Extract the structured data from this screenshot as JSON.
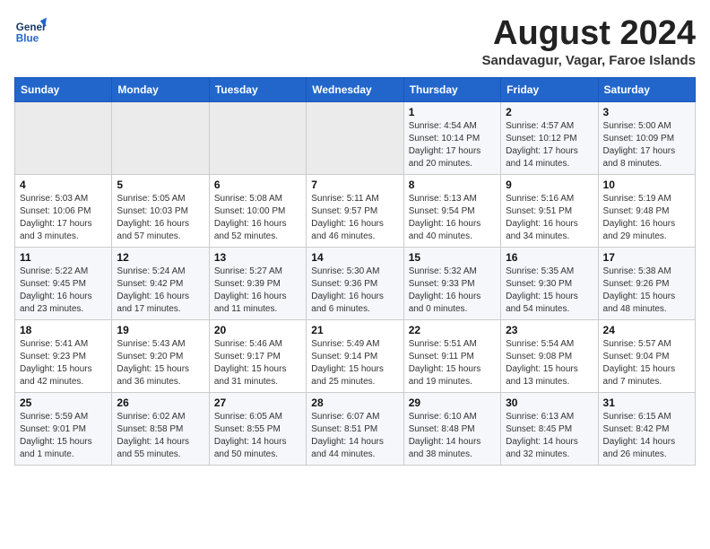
{
  "header": {
    "logo_line1": "General",
    "logo_line2": "Blue",
    "main_title": "August 2024",
    "subtitle": "Sandavagur, Vagar, Faroe Islands"
  },
  "calendar": {
    "days_of_week": [
      "Sunday",
      "Monday",
      "Tuesday",
      "Wednesday",
      "Thursday",
      "Friday",
      "Saturday"
    ],
    "weeks": [
      [
        {
          "day": "",
          "info": ""
        },
        {
          "day": "",
          "info": ""
        },
        {
          "day": "",
          "info": ""
        },
        {
          "day": "",
          "info": ""
        },
        {
          "day": "1",
          "info": "Sunrise: 4:54 AM\nSunset: 10:14 PM\nDaylight: 17 hours\nand 20 minutes."
        },
        {
          "day": "2",
          "info": "Sunrise: 4:57 AM\nSunset: 10:12 PM\nDaylight: 17 hours\nand 14 minutes."
        },
        {
          "day": "3",
          "info": "Sunrise: 5:00 AM\nSunset: 10:09 PM\nDaylight: 17 hours\nand 8 minutes."
        }
      ],
      [
        {
          "day": "4",
          "info": "Sunrise: 5:03 AM\nSunset: 10:06 PM\nDaylight: 17 hours\nand 3 minutes."
        },
        {
          "day": "5",
          "info": "Sunrise: 5:05 AM\nSunset: 10:03 PM\nDaylight: 16 hours\nand 57 minutes."
        },
        {
          "day": "6",
          "info": "Sunrise: 5:08 AM\nSunset: 10:00 PM\nDaylight: 16 hours\nand 52 minutes."
        },
        {
          "day": "7",
          "info": "Sunrise: 5:11 AM\nSunset: 9:57 PM\nDaylight: 16 hours\nand 46 minutes."
        },
        {
          "day": "8",
          "info": "Sunrise: 5:13 AM\nSunset: 9:54 PM\nDaylight: 16 hours\nand 40 minutes."
        },
        {
          "day": "9",
          "info": "Sunrise: 5:16 AM\nSunset: 9:51 PM\nDaylight: 16 hours\nand 34 minutes."
        },
        {
          "day": "10",
          "info": "Sunrise: 5:19 AM\nSunset: 9:48 PM\nDaylight: 16 hours\nand 29 minutes."
        }
      ],
      [
        {
          "day": "11",
          "info": "Sunrise: 5:22 AM\nSunset: 9:45 PM\nDaylight: 16 hours\nand 23 minutes."
        },
        {
          "day": "12",
          "info": "Sunrise: 5:24 AM\nSunset: 9:42 PM\nDaylight: 16 hours\nand 17 minutes."
        },
        {
          "day": "13",
          "info": "Sunrise: 5:27 AM\nSunset: 9:39 PM\nDaylight: 16 hours\nand 11 minutes."
        },
        {
          "day": "14",
          "info": "Sunrise: 5:30 AM\nSunset: 9:36 PM\nDaylight: 16 hours\nand 6 minutes."
        },
        {
          "day": "15",
          "info": "Sunrise: 5:32 AM\nSunset: 9:33 PM\nDaylight: 16 hours\nand 0 minutes."
        },
        {
          "day": "16",
          "info": "Sunrise: 5:35 AM\nSunset: 9:30 PM\nDaylight: 15 hours\nand 54 minutes."
        },
        {
          "day": "17",
          "info": "Sunrise: 5:38 AM\nSunset: 9:26 PM\nDaylight: 15 hours\nand 48 minutes."
        }
      ],
      [
        {
          "day": "18",
          "info": "Sunrise: 5:41 AM\nSunset: 9:23 PM\nDaylight: 15 hours\nand 42 minutes."
        },
        {
          "day": "19",
          "info": "Sunrise: 5:43 AM\nSunset: 9:20 PM\nDaylight: 15 hours\nand 36 minutes."
        },
        {
          "day": "20",
          "info": "Sunrise: 5:46 AM\nSunset: 9:17 PM\nDaylight: 15 hours\nand 31 minutes."
        },
        {
          "day": "21",
          "info": "Sunrise: 5:49 AM\nSunset: 9:14 PM\nDaylight: 15 hours\nand 25 minutes."
        },
        {
          "day": "22",
          "info": "Sunrise: 5:51 AM\nSunset: 9:11 PM\nDaylight: 15 hours\nand 19 minutes."
        },
        {
          "day": "23",
          "info": "Sunrise: 5:54 AM\nSunset: 9:08 PM\nDaylight: 15 hours\nand 13 minutes."
        },
        {
          "day": "24",
          "info": "Sunrise: 5:57 AM\nSunset: 9:04 PM\nDaylight: 15 hours\nand 7 minutes."
        }
      ],
      [
        {
          "day": "25",
          "info": "Sunrise: 5:59 AM\nSunset: 9:01 PM\nDaylight: 15 hours\nand 1 minute."
        },
        {
          "day": "26",
          "info": "Sunrise: 6:02 AM\nSunset: 8:58 PM\nDaylight: 14 hours\nand 55 minutes."
        },
        {
          "day": "27",
          "info": "Sunrise: 6:05 AM\nSunset: 8:55 PM\nDaylight: 14 hours\nand 50 minutes."
        },
        {
          "day": "28",
          "info": "Sunrise: 6:07 AM\nSunset: 8:51 PM\nDaylight: 14 hours\nand 44 minutes."
        },
        {
          "day": "29",
          "info": "Sunrise: 6:10 AM\nSunset: 8:48 PM\nDaylight: 14 hours\nand 38 minutes."
        },
        {
          "day": "30",
          "info": "Sunrise: 6:13 AM\nSunset: 8:45 PM\nDaylight: 14 hours\nand 32 minutes."
        },
        {
          "day": "31",
          "info": "Sunrise: 6:15 AM\nSunset: 8:42 PM\nDaylight: 14 hours\nand 26 minutes."
        }
      ]
    ]
  }
}
